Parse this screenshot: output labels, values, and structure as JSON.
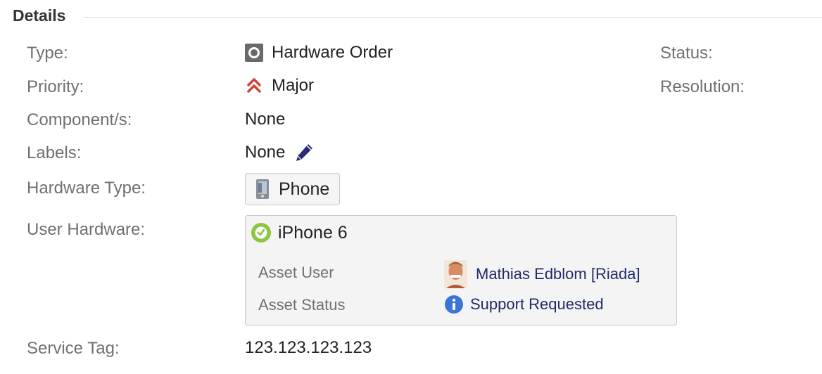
{
  "section": {
    "title": "Details"
  },
  "fields": {
    "type": {
      "label": "Type:",
      "value": "Hardware Order",
      "icon": "issue-type-icon"
    },
    "priority": {
      "label": "Priority:",
      "value": "Major",
      "icon": "priority-major-icon",
      "color": "#d04437"
    },
    "components": {
      "label": "Component/s:",
      "value": "None"
    },
    "labels": {
      "label": "Labels:",
      "value": "None",
      "icon": "pencil-icon"
    },
    "hardware_type": {
      "label": "Hardware Type:",
      "value": "Phone",
      "icon": "phone-icon"
    },
    "user_hardware": {
      "label": "User Hardware:",
      "title": "iPhone 6",
      "icon": "check-circle-icon",
      "attributes": [
        {
          "name": "Asset User",
          "value": "Mathias Edblom [Riada]",
          "icon": "avatar"
        },
        {
          "name": "Asset Status",
          "value": "Support Requested",
          "icon": "info-icon"
        }
      ]
    },
    "service_tag": {
      "label": "Service Tag:",
      "value": "123.123.123.123"
    }
  },
  "right_fields": {
    "status": {
      "label": "Status:"
    },
    "resolution": {
      "label": "Resolution:"
    }
  },
  "colors": {
    "link": "#1f2b6b",
    "label": "#707070",
    "check": "#8cc63f",
    "info": "#3b73d9"
  }
}
